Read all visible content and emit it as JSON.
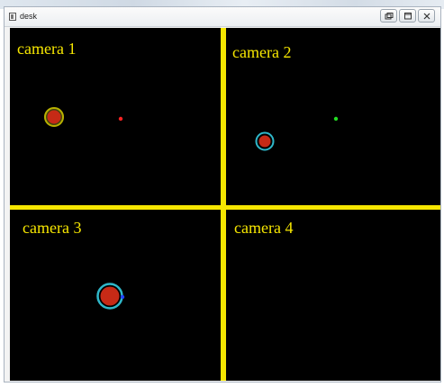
{
  "window": {
    "title": "desk"
  },
  "cameras": [
    {
      "label": "camera 1"
    },
    {
      "label": "camera 2"
    },
    {
      "label": "camera 3"
    },
    {
      "label": "camera 4"
    }
  ],
  "colors": {
    "divider": "#f6e600",
    "label": "#f6e600",
    "background": "#000000",
    "ball_fill": "#c62a16",
    "ring_yellow": "#b8b000",
    "ring_cyan": "#2fb7c9",
    "marker_red": "#ff2222",
    "marker_green": "#22dd22",
    "marker_blue": "#2244ff"
  },
  "icons": {
    "app": "window-app-icon",
    "buttons": [
      "restore-icon",
      "maximize-icon",
      "close-icon"
    ]
  }
}
